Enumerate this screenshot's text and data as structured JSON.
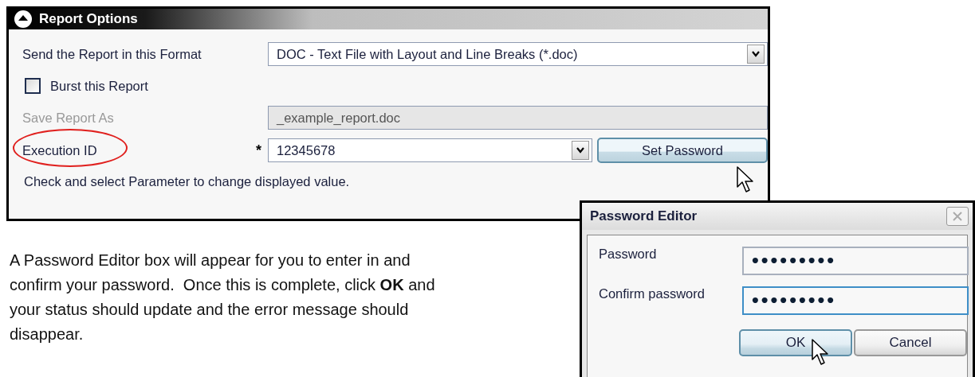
{
  "report_options": {
    "title": "Report Options",
    "expanded": true,
    "format": {
      "label": "Send the Report in this Format",
      "value": "DOC - Text File with Layout and Line Breaks (*.doc)"
    },
    "burst": {
      "label": "Burst this Report",
      "checked": false
    },
    "save_as": {
      "label": "Save Report As",
      "value": "_example_report.doc",
      "disabled": true
    },
    "execution_id": {
      "label": "Execution ID",
      "required_mark": "*",
      "value": "12345678",
      "circled": true
    },
    "set_password": {
      "label": "Set Password",
      "hovered": true
    },
    "hint": "Check and select Parameter to change displayed value."
  },
  "instructions": "A Password Editor box will appear for you to enter in and confirm your password.  Once this is complete, click **OK** and your status should update and the error message should disappear.",
  "password_dialog": {
    "title": "Password Editor",
    "fields": [
      {
        "label": "Password",
        "value": "•••••••••",
        "focused": false
      },
      {
        "label": "Confirm password",
        "value": "•••••••••",
        "focused": true
      }
    ],
    "buttons": [
      {
        "label": "OK",
        "hovered": true
      },
      {
        "label": "Cancel",
        "hovered": false
      }
    ]
  }
}
